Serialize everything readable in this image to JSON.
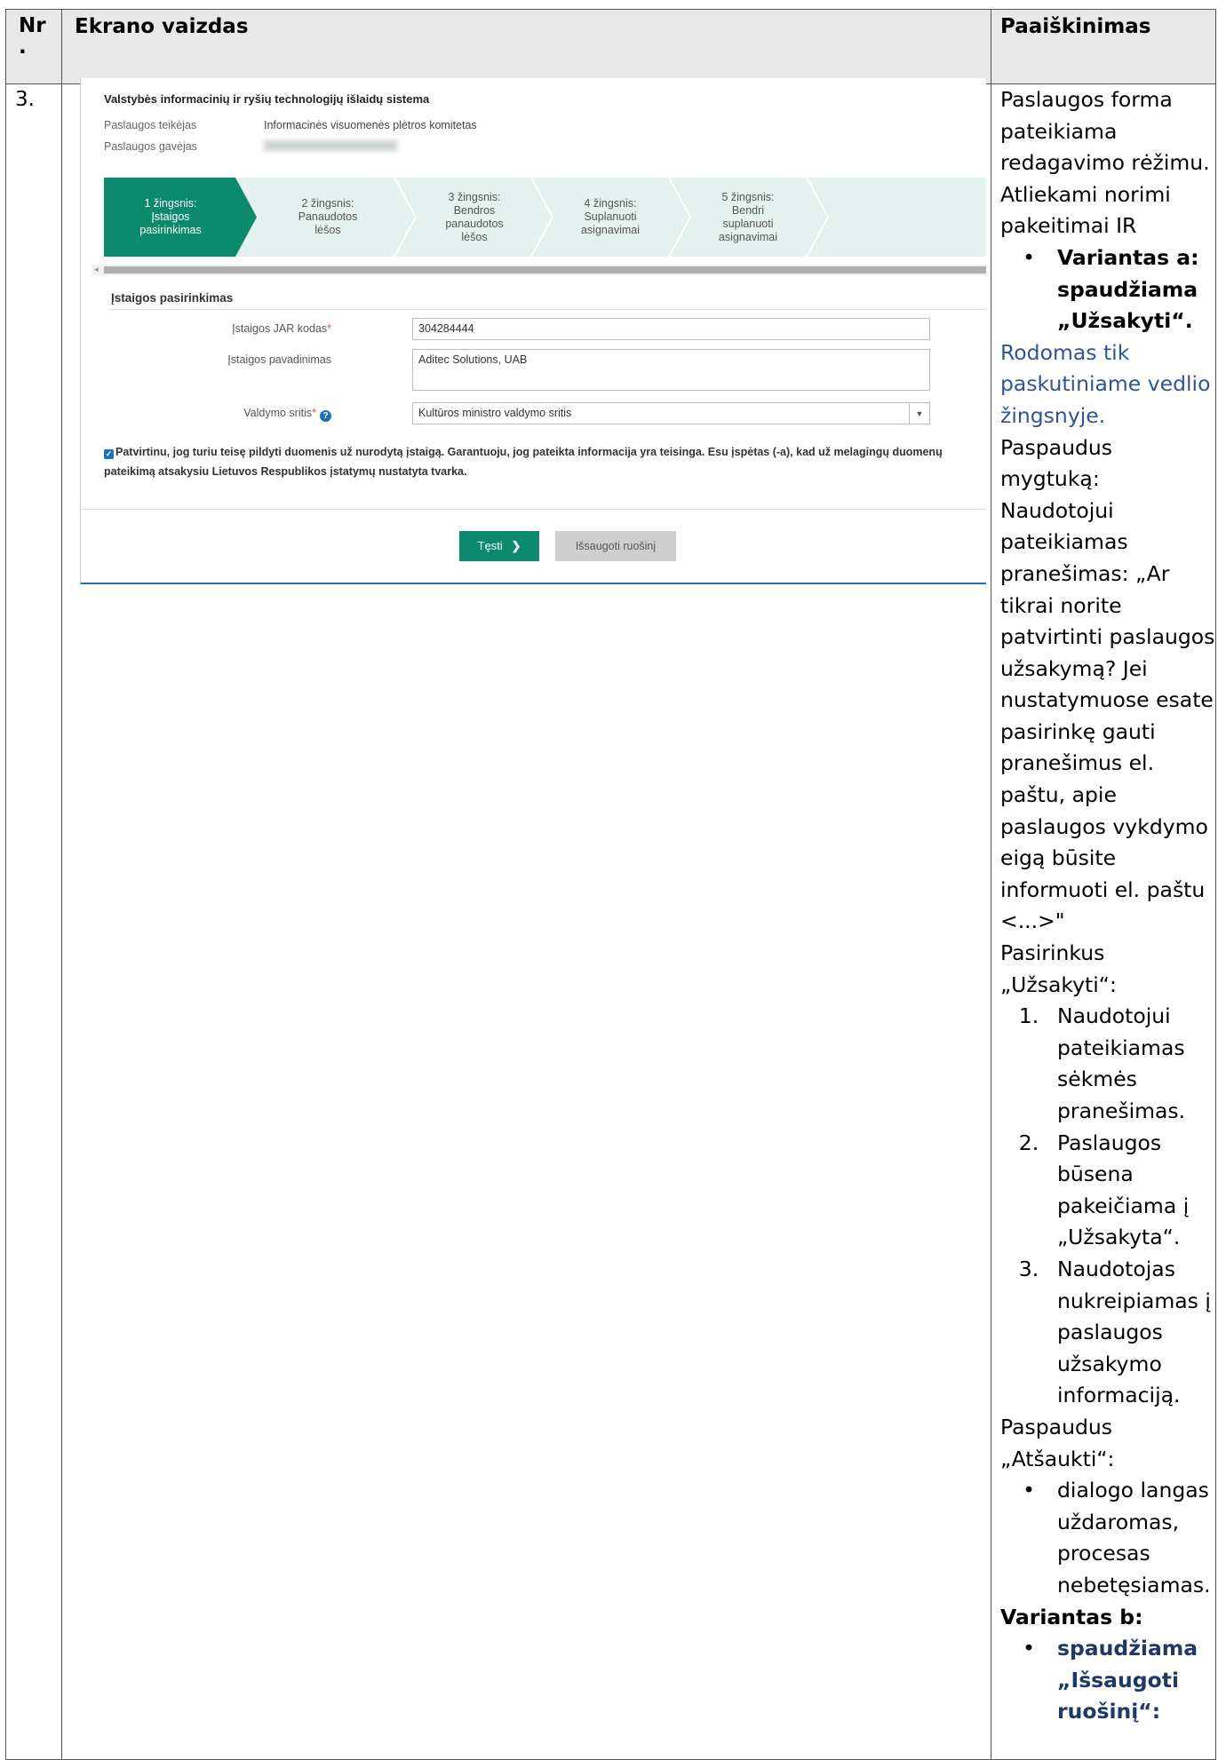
{
  "table": {
    "headers": [
      "Nr\n.",
      "Ekrano vaizdas",
      "Paaiškinimas"
    ],
    "row_number": "3."
  },
  "screen": {
    "system_title": "Valstybės informacinių ir ryšių technologijų išlaidų sistema",
    "provider_label": "Paslaugos teikėjas",
    "provider_value": "Informacinės visuomenės plėtros komitetas",
    "recipient_label": "Paslaugos gavėjas",
    "steps": [
      "1 žingsnis:\nĮstaigos\npasirinkimas",
      "2 žingsnis:\nPanaudotos\nlėšos",
      "3 žingsnis:\nBendros\npanaudotos\nlėšos",
      "4 žingsnis:\nSuplanuoti\nasignavimai",
      "5 žingsnis:\nBendri\nsuplanuoti\nasignavimai"
    ],
    "section_title": "Įstaigos pasirinkimas",
    "jar_label": "Įstaigos JAR kodas",
    "jar_value": "304284444",
    "name_label": "Įstaigos pavadinimas",
    "name_value": "Aditec Solutions, UAB",
    "area_label": "Valdymo sritis",
    "area_value": "Kultūros ministro valdymo sritis",
    "consent_text": "Patvirtinu, jog turiu teisę pildyti duomenis už nurodytą įstaigą. Garantuoju, jog pateikta informacija yra teisinga. Esu įspėtas (-a), kad už melagingų duomenų pateikimą atsakysiu Lietuvos Respublikos įstatymų nustatyta tvarka.",
    "next_button": "Tęsti",
    "save_button": "Išsaugoti ruošinį",
    "colors": {
      "step_active": "#0b8a6e",
      "step_inactive": "#e3f2ee",
      "accent_blue": "#1a73b8"
    }
  },
  "explanation": {
    "intro": "Paslaugos forma pateikiama redagavimo rėžimu. Atliekami norimi pakeitimai IR",
    "variant_a": "Variantas a: spaudžiama „Užsakyti“.",
    "note_blue": "Rodomas tik paskutiniame vedlio žingsnyje.",
    "p1": "Paspaudus mygtuką:",
    "p2": "Naudotojui pateikiamas pranešimas: „Ar tikrai norite patvirtinti paslaugos užsakymą? Jei nustatymuose esate pasirinkę gauti pranešimus el. paštu, apie paslaugos vykdymo eigą būsite informuoti el. paštu <...>\"",
    "p3": "Pasirinkus „Užsakyti“:",
    "ordered": [
      "Naudotojui pateikiamas sėkmės pranešimas.",
      "Paslaugos būsena pakeičiama į „Užsakyta“.",
      "Naudotojas nukreipiamas į paslaugos užsakymo informaciją."
    ],
    "p4": "Paspaudus „Atšaukti“:",
    "cancel_item": "dialogo langas uždaromas, procesas nebetęsiamas.",
    "variant_b": "Variantas b:",
    "variant_b_item": "spaudžiama „Išsaugoti ruošinį“:"
  }
}
